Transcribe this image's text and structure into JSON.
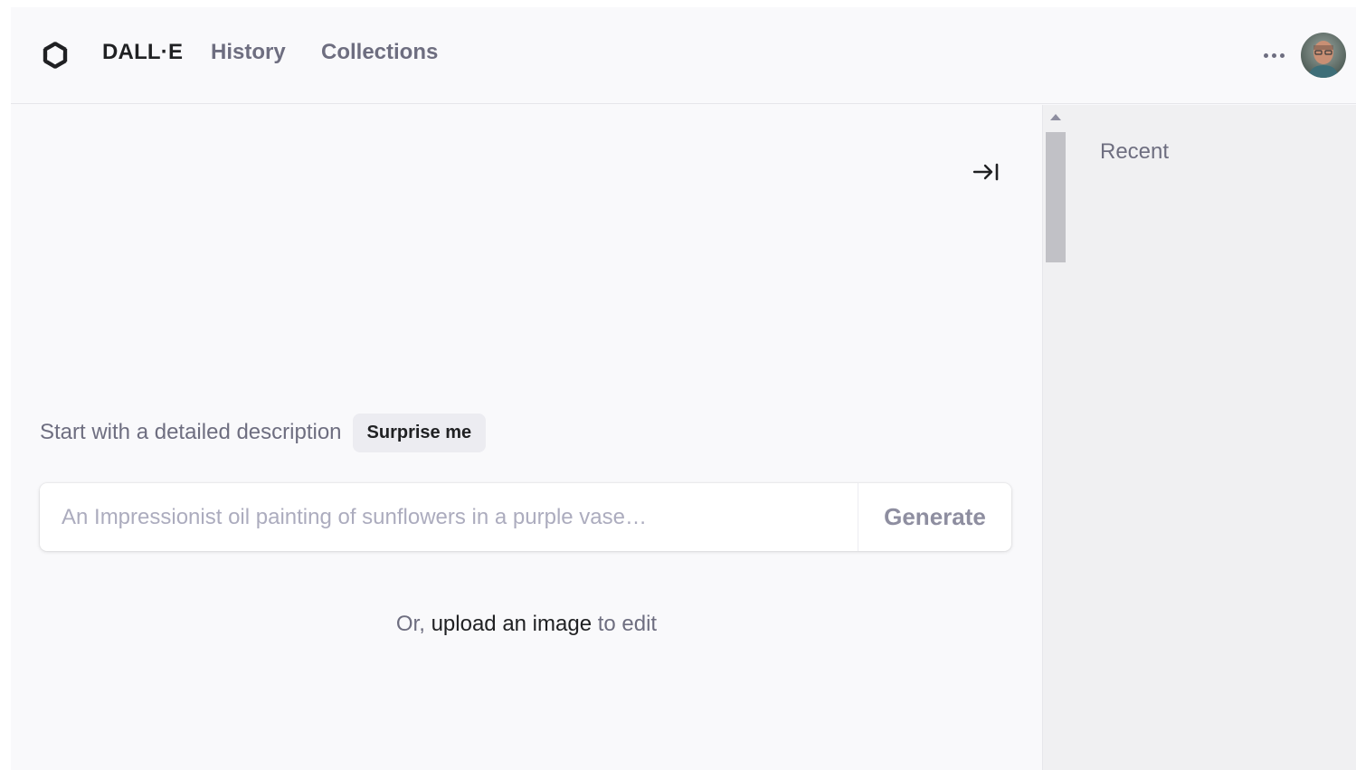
{
  "header": {
    "brand": "DALL·E",
    "nav": [
      "History",
      "Collections"
    ],
    "more_icon": "ellipsis-icon",
    "avatar_icon": "user-avatar"
  },
  "main": {
    "prompt_label": "Start with a detailed description",
    "surprise_label": "Surprise me",
    "prompt_placeholder": "An Impressionist oil painting of sunflowers in a purple vase…",
    "generate_label": "Generate",
    "upload_prefix": "Or,",
    "upload_link": "upload an image",
    "upload_suffix": "to edit",
    "collapse_icon": "collapse-right-icon"
  },
  "sidebar": {
    "title": "Recent"
  },
  "colors": {
    "background": "#f9f9fb",
    "sidebar": "#f0f0f2",
    "text_primary": "#202123",
    "text_secondary": "#6e6e80",
    "placeholder": "#acacbe"
  }
}
